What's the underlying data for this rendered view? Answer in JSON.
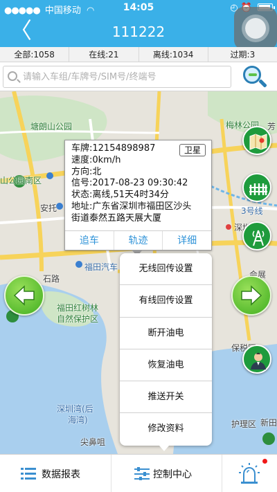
{
  "status_bar": {
    "carrier": "中国移动",
    "time": "14:05"
  },
  "nav": {
    "title": "111222",
    "back_symbol": "〈"
  },
  "stats": {
    "all": "全部:1058",
    "online": "在线:21",
    "offline": "离线:1034",
    "expired": "过期:3"
  },
  "search": {
    "placeholder": "请输入车组/车牌号/SIM号/终端号",
    "value": ""
  },
  "map_labels": [
    "塘朗山公园",
    "梅林公园",
    "山公园南区",
    "安托",
    "深圳",
    "福田汽车",
    "石路",
    "福田红树林",
    "自然保护区",
    "深圳湾(后",
    "海湾)",
    "尖鼻咀",
    "保税区",
    "护理区",
    "新田",
    "会展",
    "3号线",
    "芳"
  ],
  "vehicle_popup": {
    "plate": "车牌:12154898987",
    "speed": "速度:0km/h",
    "direction": "方向:北",
    "signal": "信号:2017-08-23 09:30:42",
    "status": "状态:离线,51天4时34分",
    "address_line1": "地址:广东省深圳市福田区沙头",
    "address_line2": "街道泰然五路天展大厦",
    "tag": "卫星",
    "actions": {
      "track": "追车",
      "trajectory": "轨迹",
      "detail": "详细"
    }
  },
  "control_menu": {
    "items": [
      "无线回传设置",
      "有线回传设置",
      "断开油电",
      "恢复油电",
      "推送开关",
      "修改资料"
    ]
  },
  "side_buttons": [
    "map-icon",
    "fence-icon",
    "tower-icon",
    "person-icon"
  ],
  "tabs": {
    "report": "数据报表",
    "control": "控制中心",
    "alarm_icon": "alarm-light-icon"
  },
  "colors": {
    "primary": "#3ab0e8",
    "action_text": "#2f93d8",
    "green_button": "#1e9b3c",
    "alert_dot": "#f01818"
  }
}
